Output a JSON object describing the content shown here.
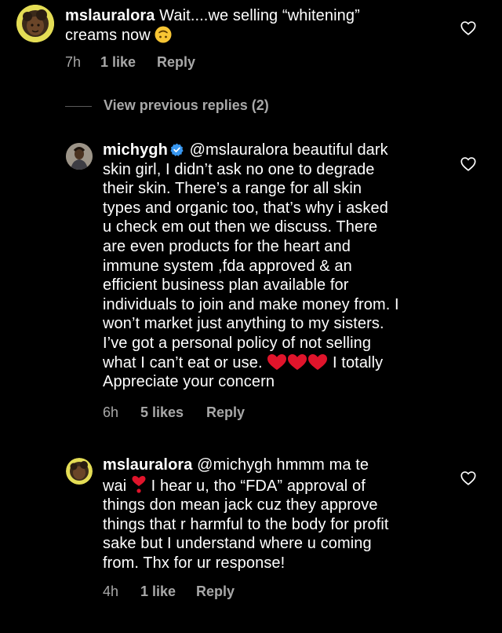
{
  "comments": [
    {
      "username": "mslauralora",
      "text_1": "Wait....we selling “whitening”",
      "text_2": "creams now",
      "emoji": "upside-down-face",
      "time": "7h",
      "likes": "1 like",
      "reply": "Reply"
    },
    {
      "username": "michygh",
      "verified": true,
      "mention": "@mslauralora",
      "lines": [
        "skin girl, I didn’t ask no one to degrade",
        "their skin. There’s a range for all skin",
        "types and organic too, that’s why i asked",
        "u check em out then we discuss. There",
        "are even products for the heart and",
        "immune system ,fda approved & an",
        "efficient business plan available for",
        "individuals to join and make money from. I",
        "won’t market just anything to my sisters.",
        "I’ve got a personal policy of not selling"
      ],
      "first_line_rest": "beautiful dark",
      "line_before_hearts": "what I can’t eat or use.",
      "line_after_hearts": "I totally",
      "last_line": "Appreciate your concern",
      "emoji": "red-heart x3",
      "time": "6h",
      "likes": "5 likes",
      "reply": "Reply"
    },
    {
      "username": "mslauralora",
      "mention": "@michygh",
      "first_line_rest": "hmmm ma te",
      "line2_start": "wai",
      "emoji": "heart-exclamation",
      "line2_rest": "I hear u, tho “FDA” approval of",
      "lines": [
        "things don mean jack cuz they approve",
        "things that r harmful to the body for profit",
        "sake but I understand where u coming",
        "from. Thx for ur response!"
      ],
      "time": "4h",
      "likes": "1 like",
      "reply": "Reply"
    }
  ],
  "view_previous": "View previous replies (2)",
  "colors": {
    "background": "#000000",
    "text": "#ffffff",
    "meta": "#a8a8a8",
    "verified": "#3897f0",
    "heart": "#e0142b"
  },
  "icons": [
    "heart-outline-icon",
    "verified-badge-icon",
    "upside-down-face-emoji",
    "red-heart-emoji",
    "heart-exclamation-emoji"
  ]
}
